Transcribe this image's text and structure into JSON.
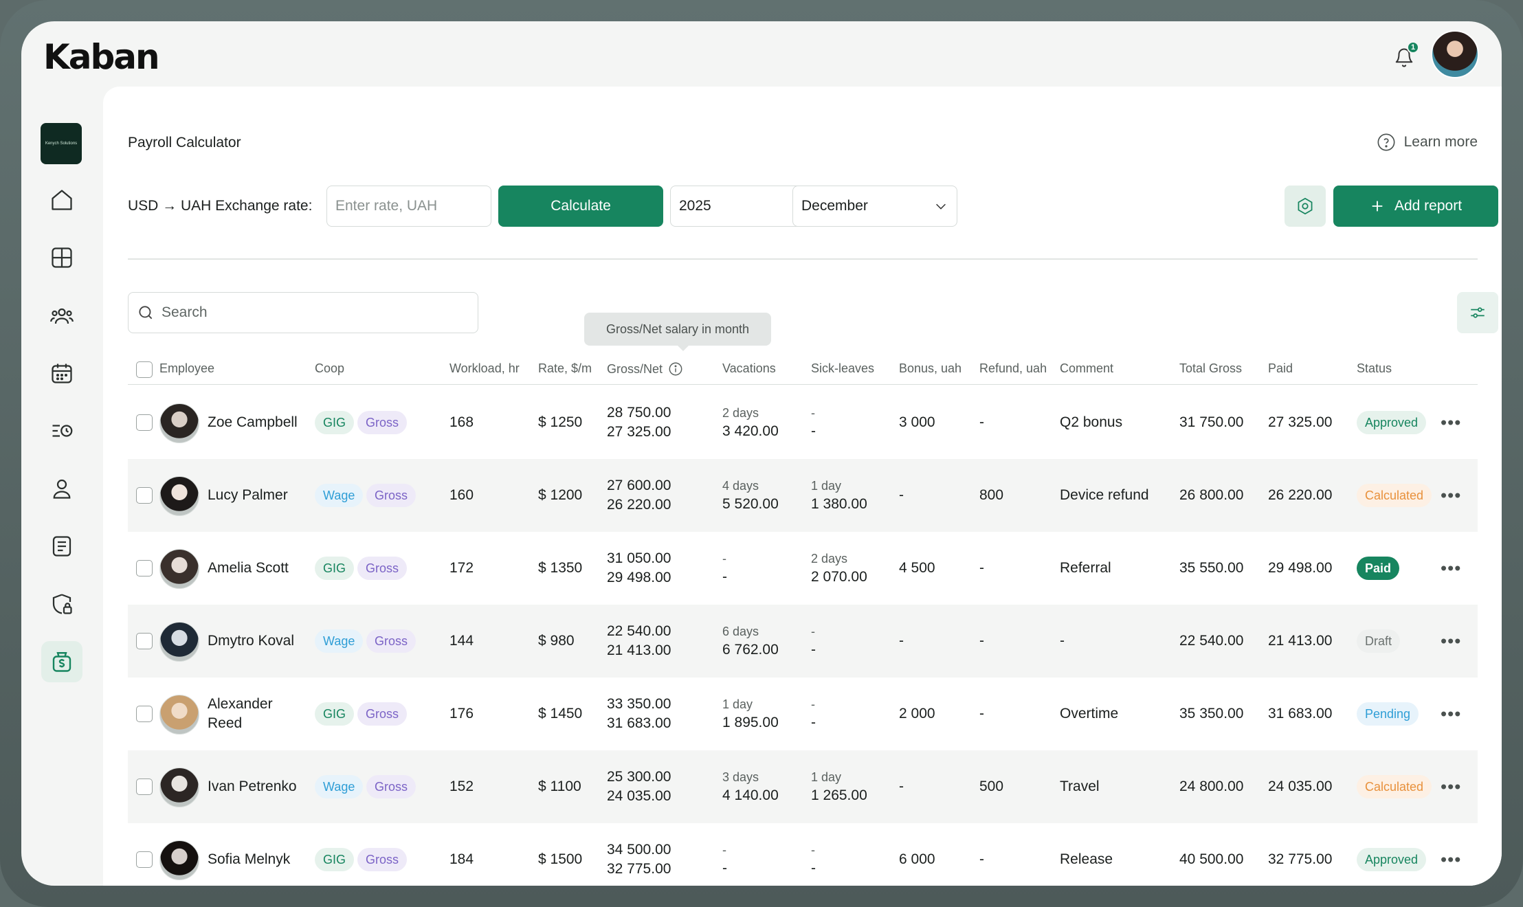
{
  "app": {
    "logo": "Kaban",
    "notifications_count": "1",
    "company_logo_text": "Kenych Solutions"
  },
  "page": {
    "title": "Payroll Calculator",
    "learn_more": "Learn more"
  },
  "toolbar": {
    "rate_label": "USD → UAH Exchange rate:",
    "rate_placeholder": "Enter rate, UAH",
    "calculate_label": "Calculate",
    "year": "2025",
    "month": "December",
    "add_report_label": "Add report"
  },
  "search": {
    "placeholder": "Search"
  },
  "tooltip": "Gross/Net salary in month",
  "columns": {
    "employee": "Employee",
    "coop": "Coop",
    "workload": "Workload, hr",
    "rate": "Rate, $/m",
    "gross_net": "Gross/Net",
    "vacations": "Vacations",
    "sick_leaves": "Sick-leaves",
    "bonus": "Bonus, uah",
    "refund": "Refund, uah",
    "comment": "Comment",
    "total_gross": "Total Gross",
    "paid": "Paid",
    "status": "Status"
  },
  "colors": {
    "accent": "#17855f",
    "background": "#f4f5f4"
  },
  "rows": [
    {
      "name": [
        "Zoe Campbell"
      ],
      "coop": "GIG",
      "basis": "Gross",
      "workload": "168",
      "rate": "$ 1250",
      "gross": "28 750.00",
      "net": "27 325.00",
      "vac_days": "2 days",
      "vac_amount": "3 420.00",
      "sick_days": "-",
      "sick_amount": "-",
      "bonus": "3 000",
      "refund": "-",
      "comment": "Q2 bonus",
      "total_gross": "31 750.00",
      "paid": "27 325.00",
      "status": "Approved",
      "status_kind": "approved"
    },
    {
      "name": [
        "Lucy Palmer"
      ],
      "coop": "Wage",
      "basis": "Gross",
      "workload": "160",
      "rate": "$ 1200",
      "gross": "27 600.00",
      "net": "26 220.00",
      "vac_days": "4 days",
      "vac_amount": "5 520.00",
      "sick_days": "1 day",
      "sick_amount": "1 380.00",
      "bonus": "-",
      "refund": "800",
      "comment": "Device refund",
      "total_gross": "26 800.00",
      "paid": "26 220.00",
      "status": "Calculated",
      "status_kind": "calculated"
    },
    {
      "name": [
        "Amelia Scott"
      ],
      "coop": "GIG",
      "basis": "Gross",
      "workload": "172",
      "rate": "$ 1350",
      "gross": "31 050.00",
      "net": "29 498.00",
      "vac_days": "-",
      "vac_amount": "-",
      "sick_days": "2 days",
      "sick_amount": "2 070.00",
      "bonus": "4 500",
      "refund": "-",
      "comment": "Referral",
      "total_gross": "35 550.00",
      "paid": "29 498.00",
      "status": "Paid",
      "status_kind": "paid"
    },
    {
      "name": [
        "Dmytro Koval"
      ],
      "coop": "Wage",
      "basis": "Gross",
      "workload": "144",
      "rate": "$ 980",
      "gross": "22 540.00",
      "net": "21 413.00",
      "vac_days": "6 days",
      "vac_amount": "6 762.00",
      "sick_days": "-",
      "sick_amount": "-",
      "bonus": "-",
      "refund": "-",
      "comment": "-",
      "total_gross": "22 540.00",
      "paid": "21 413.00",
      "status": "Draft",
      "status_kind": "draft"
    },
    {
      "name": [
        "Alexander",
        "Reed"
      ],
      "coop": "GIG",
      "basis": "Gross",
      "workload": "176",
      "rate": "$ 1450",
      "gross": "33 350.00",
      "net": "31 683.00",
      "vac_days": "1 day",
      "vac_amount": "1 895.00",
      "sick_days": "-",
      "sick_amount": "-",
      "bonus": "2 000",
      "refund": "-",
      "comment": "Overtime",
      "total_gross": "35 350.00",
      "paid": "31 683.00",
      "status": "Pending",
      "status_kind": "pending"
    },
    {
      "name": [
        "Ivan Petrenko"
      ],
      "coop": "Wage",
      "basis": "Gross",
      "workload": "152",
      "rate": "$ 1100",
      "gross": "25 300.00",
      "net": "24 035.00",
      "vac_days": "3 days",
      "vac_amount": "4 140.00",
      "sick_days": "1 day",
      "sick_amount": "1 265.00",
      "bonus": "-",
      "refund": "500",
      "comment": "Travel",
      "total_gross": "24 800.00",
      "paid": "24 035.00",
      "status": "Calculated",
      "status_kind": "calculated"
    },
    {
      "name": [
        "Sofia Melnyk"
      ],
      "coop": "GIG",
      "basis": "Gross",
      "workload": "184",
      "rate": "$ 1500",
      "gross": "34 500.00",
      "net": "32 775.00",
      "vac_days": "-",
      "vac_amount": "-",
      "sick_days": "-",
      "sick_amount": "-",
      "bonus": "6 000",
      "refund": "-",
      "comment": "Release",
      "total_gross": "40 500.00",
      "paid": "32 775.00",
      "status": "Approved",
      "status_kind": "approved"
    }
  ]
}
